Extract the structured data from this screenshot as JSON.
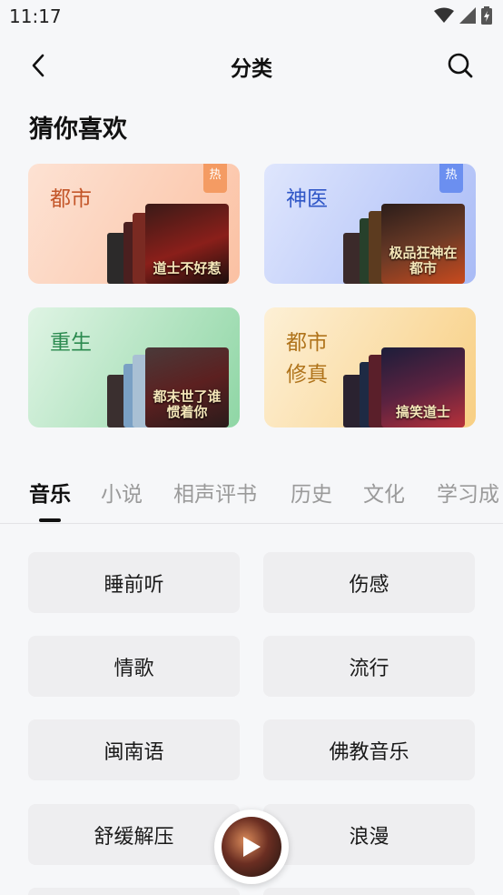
{
  "status_bar": {
    "time": "11:17"
  },
  "nav": {
    "title": "分类"
  },
  "section": {
    "title": "猜你喜欢"
  },
  "cards": [
    {
      "label": "都市",
      "hot_badge": "热",
      "book_title": "道士不好惹"
    },
    {
      "label": "神医",
      "hot_badge": "热",
      "book_title": "极品狂神在都市"
    },
    {
      "label": "重生",
      "book_title": "都末世了谁惯着你"
    },
    {
      "label_line1": "都市",
      "label_line2": "修真",
      "book_title": "搞笑道士"
    }
  ],
  "tabs": [
    "音乐",
    "小说",
    "相声评书",
    "历史",
    "文化",
    "学习成"
  ],
  "categories": [
    "睡前听",
    "伤感",
    "情歌",
    "流行",
    "闽南语",
    "佛教音乐",
    "舒缓解压",
    "浪漫"
  ],
  "colors": {
    "accent_text": "#111111",
    "tab_inactive": "#9a9a9a"
  }
}
